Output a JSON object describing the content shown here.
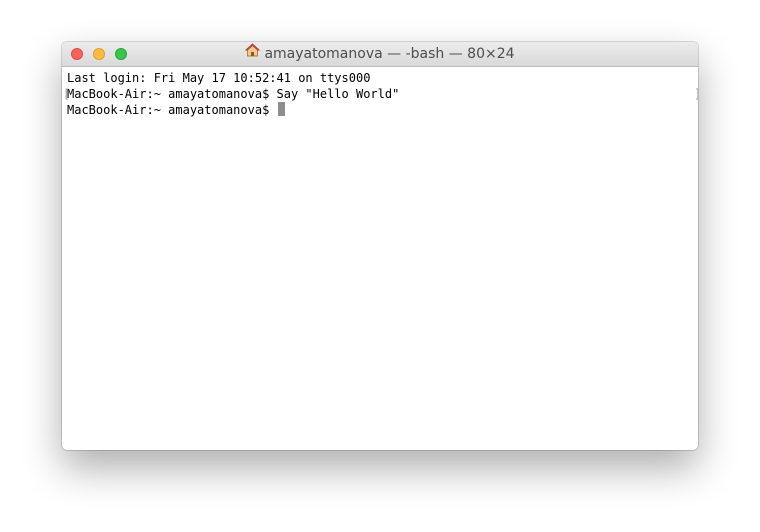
{
  "window": {
    "title": "amayatomanova — -bash — 80×24",
    "title_icon": "home-icon"
  },
  "terminal": {
    "lines": [
      "Last login: Fri May 17 10:52:41 on ttys000",
      "MacBook-Air:~ amayatomanova$ Say \"Hello World\"",
      "MacBook-Air:~ amayatomanova$ "
    ],
    "mark_left": "[",
    "mark_right": "]"
  },
  "colors": {
    "close": "#fc605c",
    "minimize": "#fdbc40",
    "zoom": "#34c84a",
    "cursor": "#8e8e8e"
  }
}
